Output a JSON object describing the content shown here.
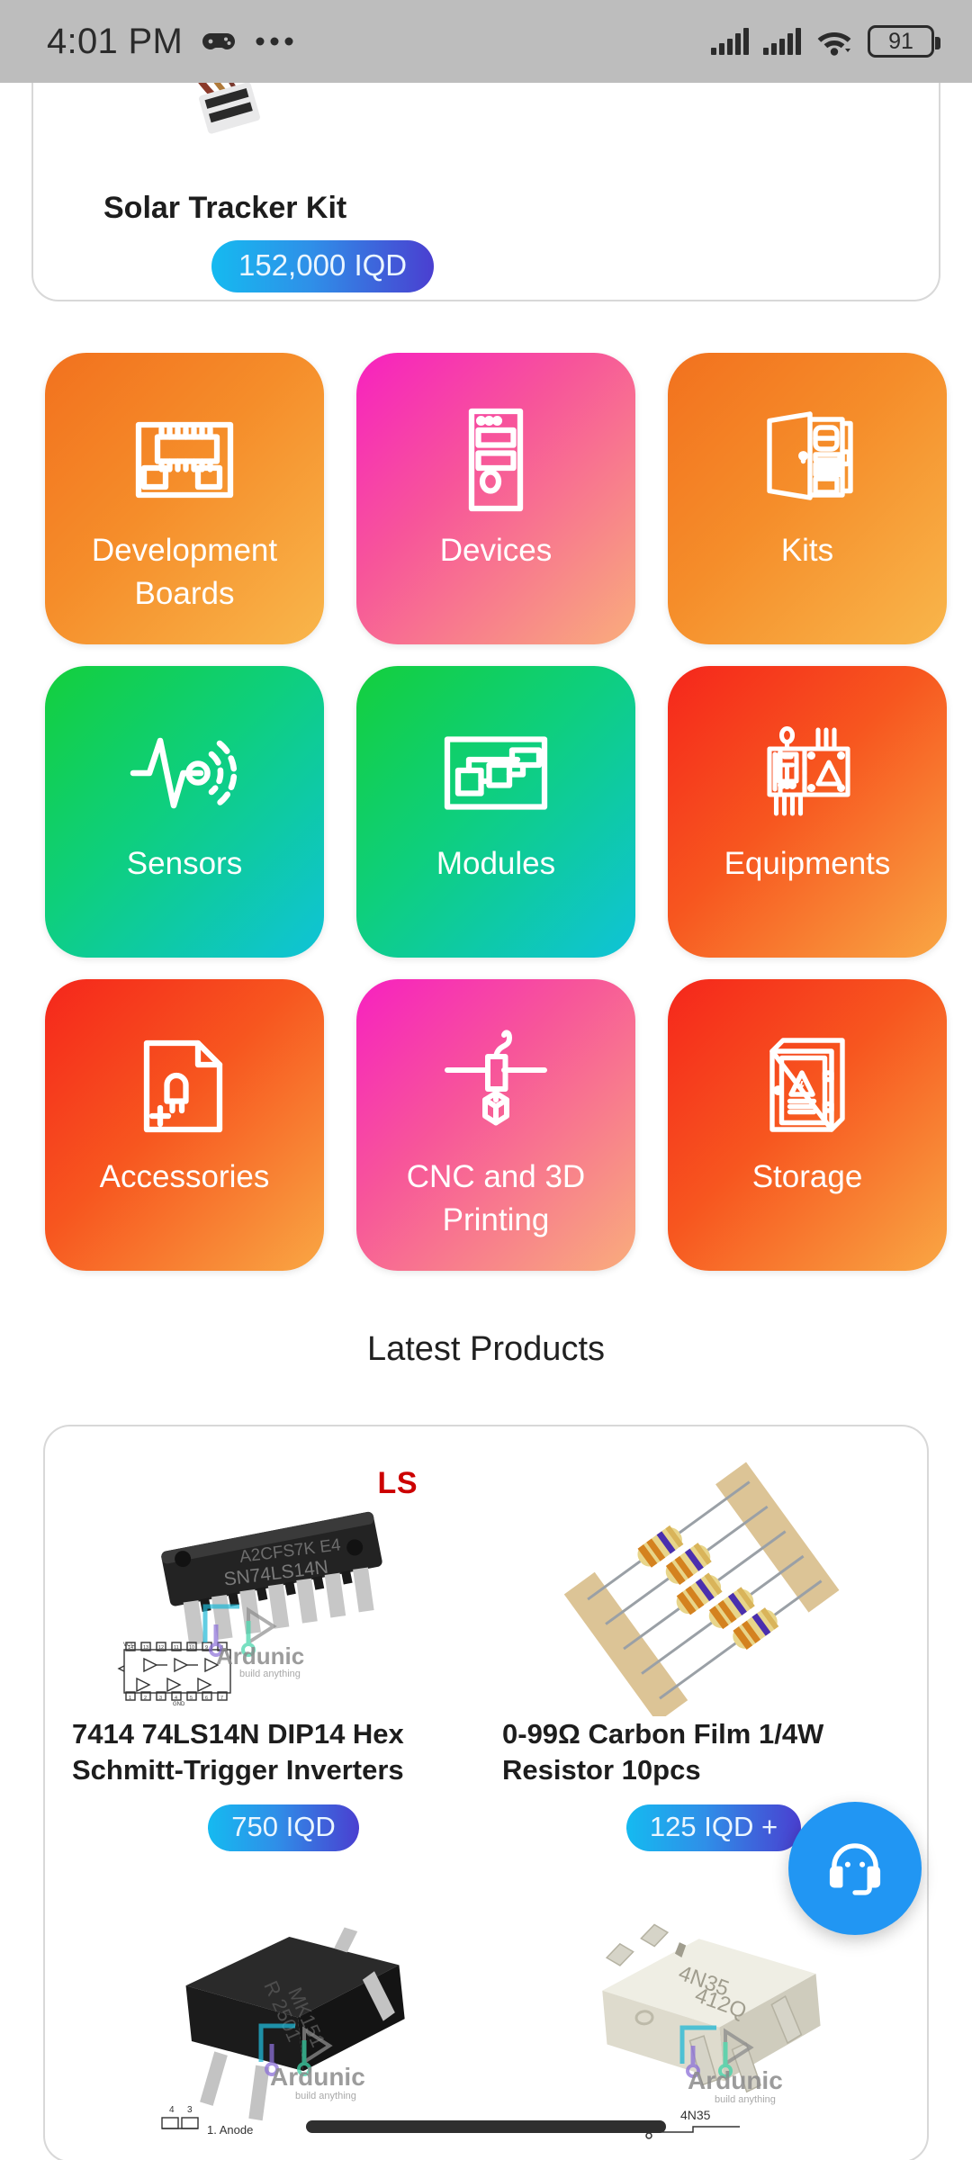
{
  "status_bar": {
    "time": "4:01 PM",
    "battery_level": "91",
    "icons": [
      "gamepad-icon",
      "overflow-menu-icon",
      "signal-bars-icon",
      "signal-bars-icon",
      "wifi-icon",
      "battery-icon"
    ]
  },
  "featured": {
    "title": "Solar Tracker Kit",
    "price": "152,000 IQD",
    "image_alt": "solar-tracker-kit-photo"
  },
  "categories": [
    {
      "label": "Development Boards",
      "icon": "microcontroller-board-icon",
      "theme": "orange"
    },
    {
      "label": "Devices",
      "icon": "pc-tower-icon",
      "theme": "pink"
    },
    {
      "label": "Kits",
      "icon": "open-cabinet-icon",
      "theme": "orange"
    },
    {
      "label": "Sensors",
      "icon": "waveform-signal-icon",
      "theme": "green"
    },
    {
      "label": "Modules",
      "icon": "block-diagram-icon",
      "theme": "green"
    },
    {
      "label": "Equipments",
      "icon": "circuit-panel-icon",
      "theme": "red"
    },
    {
      "label": "Accessories",
      "icon": "document-led-plus-icon",
      "theme": "red"
    },
    {
      "label": "CNC and 3D Printing",
      "icon": "3d-printer-extruder-icon",
      "theme": "pink"
    },
    {
      "label": "Storage",
      "icon": "electrical-cabinet-icon",
      "theme": "red"
    }
  ],
  "sections": {
    "latest_products_heading": "Latest Products"
  },
  "products": [
    {
      "title": "7414 74LS14N DIP14 Hex Schmitt-Trigger Inverters",
      "price": "750 IQD",
      "badge": "LS",
      "image_alt": "sn74ls14n-dip14-ic-photo"
    },
    {
      "title": "0-99Ω Carbon Film 1/4W Resistor 10pcs",
      "price": "125 IQD +",
      "image_alt": "taped-carbon-film-resistors-photo"
    },
    {
      "title": "",
      "price": "",
      "image_alt": "black-optocoupler-dip4-photo"
    },
    {
      "title": "",
      "price": "",
      "image_alt": "white-4n35-optocoupler-photo"
    }
  ],
  "watermark": {
    "brand": "Ardunic",
    "tagline": "build anything"
  },
  "fab": {
    "icon": "headset-support-icon",
    "color": "#2196f3"
  },
  "colors": {
    "price_pill_start": "#15baf0",
    "price_pill_end": "#4a3fd0",
    "badge_red": "#cc0000",
    "status_bar_bg": "#bdbdbd"
  }
}
